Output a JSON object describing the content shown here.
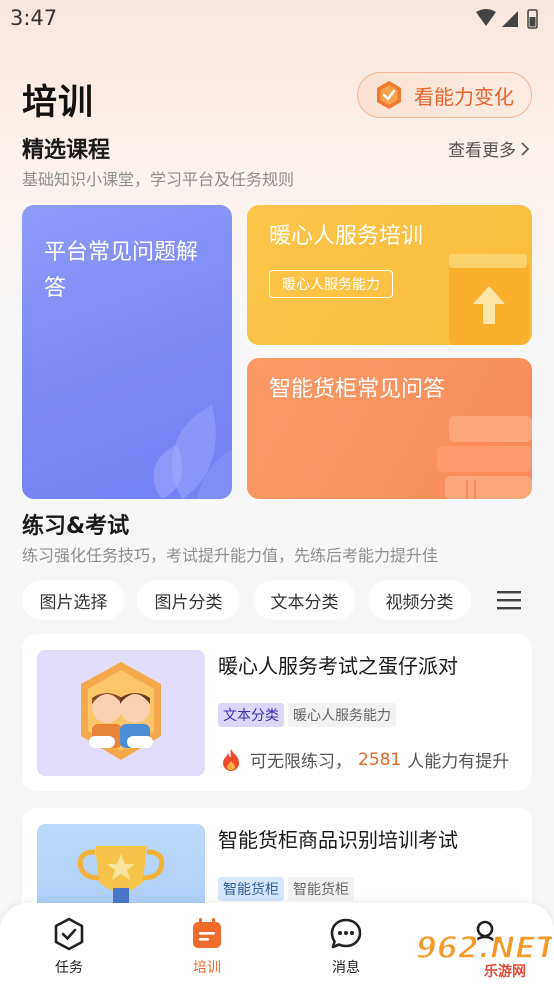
{
  "status_bar": {
    "time": "3:47"
  },
  "header": {
    "title": "培训",
    "ability_button_label": "看能力变化"
  },
  "courses": {
    "title": "精选课程",
    "subtitle": "基础知识小课堂，学习平台及任务规则",
    "see_more": "查看更多",
    "cards": [
      {
        "title": "平台常见问题解答"
      },
      {
        "title": "暖心人服务培训",
        "tag": "暖心人服务能力"
      },
      {
        "title": "智能货柜常见问答"
      }
    ]
  },
  "practice": {
    "title": "练习&考试",
    "subtitle": "练习强化任务技巧，考试提升能力值，先练后考能力提升佳",
    "chips": [
      "图片选择",
      "图片分类",
      "文本分类",
      "视频分类"
    ],
    "exams": [
      {
        "title": "暖心人服务考试之蛋仔派对",
        "type_tag": "文本分类",
        "ability_tag": "暖心人服务能力",
        "stat_prefix": "可无限练习，",
        "stat_count": "2581",
        "stat_suffix": "人能力有提升"
      },
      {
        "title": "智能货柜商品识别培训考试",
        "type_tag": "智能货柜",
        "ability_tag": "智能货柜"
      }
    ]
  },
  "tabbar": {
    "items": [
      {
        "label": "任务",
        "icon": "task-check-icon"
      },
      {
        "label": "培训",
        "icon": "training-icon"
      },
      {
        "label": "消息",
        "icon": "message-icon"
      }
    ]
  },
  "watermark": {
    "text": "962.NET",
    "sub": "乐游网"
  },
  "colors": {
    "accent": "#f06b2d",
    "card_blue": "#7c86f7",
    "card_yellow": "#fbbd3b",
    "card_orange": "#fa8a5a"
  }
}
